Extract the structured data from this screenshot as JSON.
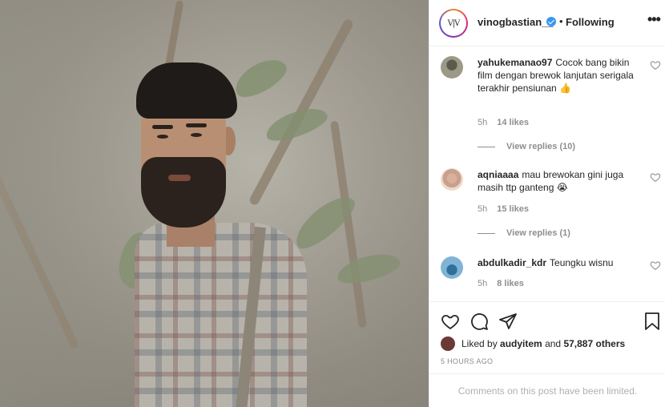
{
  "post": {
    "username": "vinogbastian__",
    "follow_status": "Following",
    "more_label": "•••",
    "avatar_text": "V|V"
  },
  "comments": [
    {
      "user": "yahukemanao97",
      "text": "Cocok bang bikin film dengan brewok lanjutan serigala terakhir pensiunan 👍",
      "age": "5h",
      "likes": "14 likes",
      "replies": "View replies (10)"
    },
    {
      "user": "aqniaaaa",
      "text": "mau brewokan gini juga masih ttp ganteng 😭",
      "age": "5h",
      "likes": "15 likes",
      "replies": "View replies (1)"
    },
    {
      "user": "abdulkadir_kdr",
      "text": "Teungku wisnu",
      "age": "5h",
      "likes": "8 likes"
    }
  ],
  "likes": {
    "prefix": "Liked by",
    "user": "audyitem",
    "joiner": "and",
    "count": "57,887 others"
  },
  "timestamp": "5 HOURS AGO",
  "comments_limited": "Comments on this post have been limited.",
  "icons": {
    "like": "heart-icon",
    "comment": "comment-icon",
    "share": "share-icon",
    "save": "bookmark-icon"
  }
}
